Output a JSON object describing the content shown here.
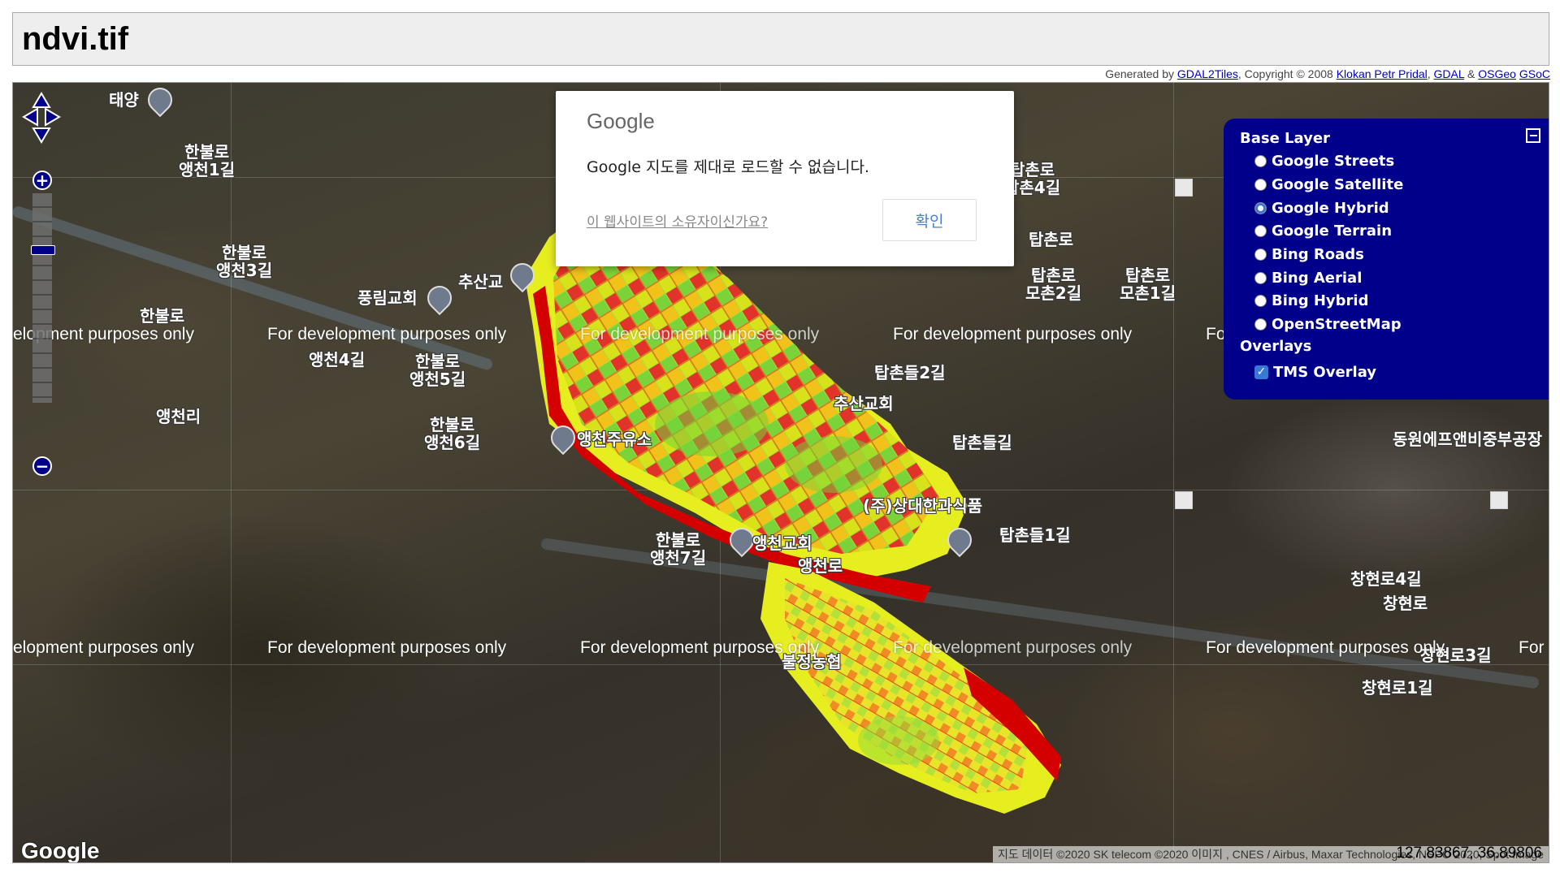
{
  "header": {
    "title": "ndvi.tif",
    "generated_by_prefix": "Generated by",
    "gdal2tiles": "GDAL2Tiles",
    "copyright": ", Copyright © 2008",
    "klokan": "Klokan Petr Pridal",
    "gdal": "GDAL",
    "amp": "&",
    "osgeo": "OSGeo",
    "gsoc": "GSoC"
  },
  "dialog": {
    "logo": "Google",
    "message": "Google 지도를 제대로 로드할 수 없습니다.",
    "owner_link": "이 웹사이트의 소유자이신가요?",
    "ok_button": "확인"
  },
  "layers": {
    "base_heading": "Base Layer",
    "base": [
      {
        "label": "Google Streets",
        "selected": false
      },
      {
        "label": "Google Satellite",
        "selected": false
      },
      {
        "label": "Google Hybrid",
        "selected": true
      },
      {
        "label": "Google Terrain",
        "selected": false
      },
      {
        "label": "Bing Roads",
        "selected": false
      },
      {
        "label": "Bing Aerial",
        "selected": false
      },
      {
        "label": "Bing Hybrid",
        "selected": false
      },
      {
        "label": "OpenStreetMap",
        "selected": false
      }
    ],
    "overlays_heading": "Overlays",
    "overlays": [
      {
        "label": "TMS Overlay",
        "checked": true
      }
    ]
  },
  "map": {
    "watermark": "For development purposes only",
    "watermark_partial_left": "elopment purposes only",
    "watermark_partial_right": "For",
    "watermark_partial_right2": "For d",
    "google_logo": "Google",
    "attribution": "지도 데이터 ©2020 SK telecom ©2020 이미지 , CNES / Airbus, Maxar Technologies, NSPO 2020, Spot Image",
    "coordinates": "127.83867, 36.89806",
    "places": {
      "p1": "태양",
      "p2": "한불로\n앵천1길",
      "p3": "한불로\n앵천3길",
      "p4": "풍림교회",
      "p5": "추산교",
      "p6": "한불로",
      "p7": "앵천4길",
      "p8": "한불로\n앵천5길",
      "p9": "앵천리",
      "p10": "한불로\n앵천6길",
      "p11": "앵천주유소",
      "p12": "탑촌로\n탑촌4길",
      "p13": "탑촌로",
      "p14": "탑촌로\n모촌2길",
      "p15": "탑촌로\n모촌1길",
      "p16": "탑촌들2길",
      "p17": "추산교회",
      "p18": "탑촌들길",
      "p19": "(주)상대한과식품",
      "p20": "탑촌들1길",
      "p21": "한불로\n앵천7길",
      "p22": "앵천교회",
      "p23": "앵천로",
      "p24": "불정농협",
      "p25": "동원에프앤비중부공장",
      "p26": "창현로4길",
      "p27": "창현로",
      "p28": "창현로3길",
      "p29": "창현로1길"
    }
  },
  "colors": {
    "brand": "#00008b",
    "ndvi_low": "#d40000",
    "ndvi_mid": "#e6f000",
    "ndvi_high": "#5fcf30"
  }
}
